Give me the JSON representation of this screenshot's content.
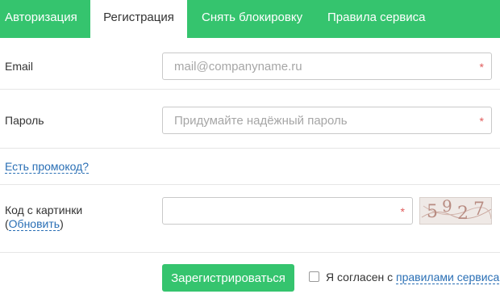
{
  "tabs": {
    "auth": "Авторизация",
    "register": "Регистрация",
    "unlock": "Снять блокировку",
    "rules": "Правила сервиса"
  },
  "form": {
    "email_label": "Email",
    "email_placeholder": "mail@companyname.ru",
    "password_label": "Пароль",
    "password_placeholder": "Придумайте надёжный пароль",
    "required_mark": "*",
    "promo_link": "Есть промокод?",
    "captcha_label": "Код с картинки",
    "captcha_refresh_open": "(",
    "captcha_refresh": "Обновить",
    "captcha_refresh_close": ")",
    "captcha_chars": [
      "5",
      "9",
      "2",
      "7"
    ],
    "submit": "Зарегистрироваться",
    "agree_text": "Я согласен с ",
    "agree_link": "правилами сервиса"
  },
  "colors": {
    "accent": "#35c46e",
    "link": "#2a6fb5",
    "required": "#e05a5a"
  }
}
